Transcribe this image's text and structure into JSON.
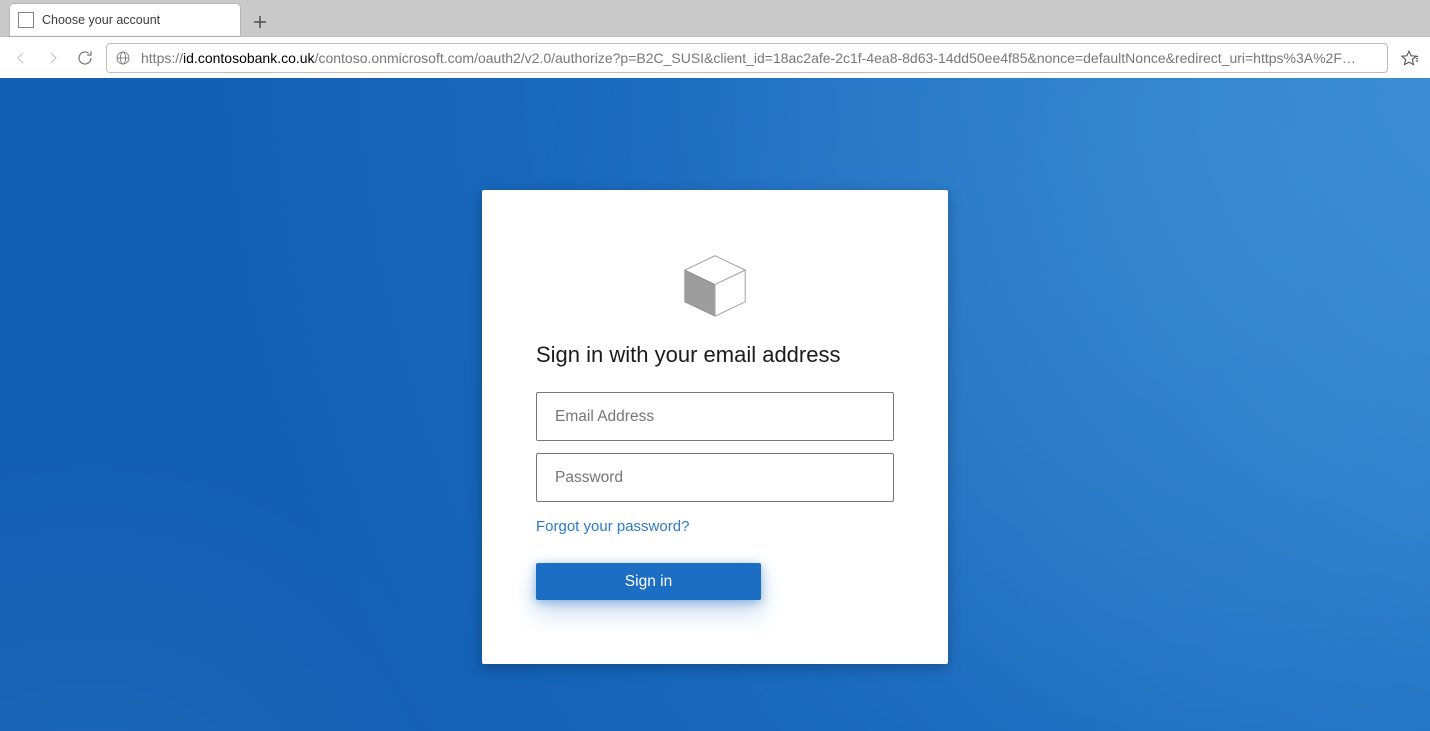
{
  "browser": {
    "tab_title": "Choose your account",
    "url_scheme": "https://",
    "url_host": "id.contosobank.co.uk",
    "url_path": "/contoso.onmicrosoft.com/oauth2/v2.0/authorize?p=B2C_SUSI&client_id=18ac2afe-2c1f-4ea8-8d63-14dd50ee4f85&nonce=defaultNonce&redirect_uri=https%3A%2F…"
  },
  "signin": {
    "heading": "Sign in with your email address",
    "email_placeholder": "Email Address",
    "password_placeholder": "Password",
    "forgot_link": "Forgot your password?",
    "submit_label": "Sign in"
  }
}
